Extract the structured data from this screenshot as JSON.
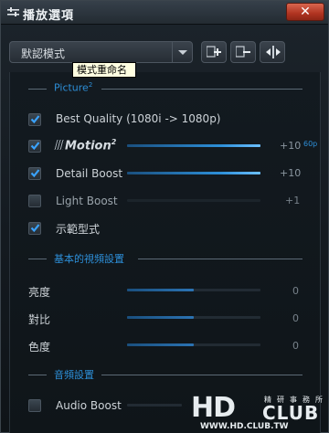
{
  "window": {
    "title": "播放選項",
    "close_label": "✕"
  },
  "toolbar": {
    "preset_value": "默認模式",
    "tooltip": "模式重命名",
    "icons": [
      "add-preset-icon",
      "remove-preset-icon",
      "split-view-icon"
    ]
  },
  "picture": {
    "section_label": "Picture",
    "section_sup": "2",
    "best_quality": {
      "label": "Best Quality (1080i -> 1080p)",
      "checked": true
    },
    "motion": {
      "label": "Motion",
      "sup": "2",
      "checked": true,
      "value": "+10",
      "value_sup": "60p",
      "level": 1.0
    },
    "detail_boost": {
      "label": "Detail Boost",
      "checked": true,
      "value": "+10",
      "level": 1.0
    },
    "light_boost": {
      "label": "Light Boost",
      "checked": false,
      "value": "+1",
      "level": 0.0
    },
    "demo_mode": {
      "label": "示範型式",
      "checked": true
    }
  },
  "video": {
    "section_label": "基本的視頻設置",
    "brightness": {
      "label": "亮度",
      "value": "0",
      "level": 0.5
    },
    "contrast": {
      "label": "對比",
      "value": "0",
      "level": 0.5
    },
    "hue": {
      "label": "色度",
      "value": "0",
      "level": 0.5
    }
  },
  "audio": {
    "section_label": "音頻設置",
    "audio_boost": {
      "label": "Audio Boost",
      "checked": false
    }
  },
  "watermark": {
    "brand": "HD",
    "brand2": "CLUB",
    "cn": "精研事務所",
    "url": "WWW.HD.CLUB.TW"
  },
  "colors": {
    "accent": "#2d8fd8",
    "close": "#b03421"
  }
}
